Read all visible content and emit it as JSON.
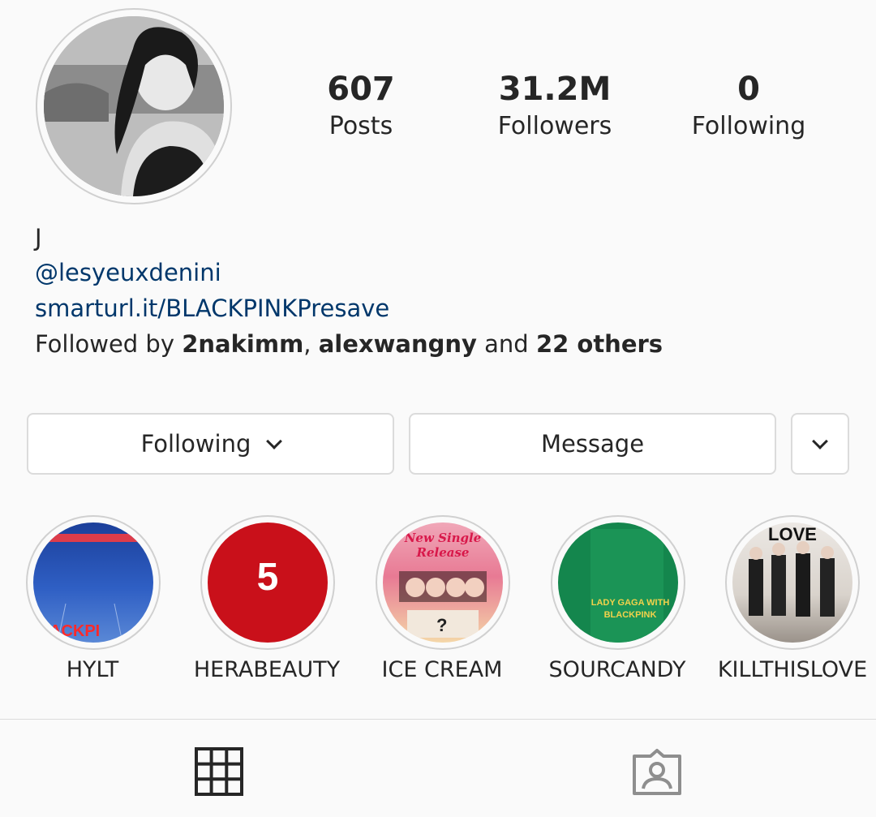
{
  "profile": {
    "name": "J",
    "mention": "@lesyeuxdenini",
    "link": "smarturl.it/BLACKPINKPresave"
  },
  "stats": [
    {
      "value": "607",
      "label": "Posts"
    },
    {
      "value": "31.2M",
      "label": "Followers"
    },
    {
      "value": "0",
      "label": "Following"
    }
  ],
  "followed_by": {
    "prefix": "Followed by ",
    "user1": "2nakimm",
    "sep": ", ",
    "user2": "alexwangny",
    "and": " and ",
    "others": "22 others"
  },
  "buttons": {
    "following": "Following",
    "message": "Message"
  },
  "highlights": [
    {
      "label": "HYLT",
      "thumb_text": "ACKPI"
    },
    {
      "label": "HERABEAUTY",
      "thumb_text": "5"
    },
    {
      "label": "ICE CREAM",
      "thumb_text": "New Single Release"
    },
    {
      "label": "SOURCANDY",
      "thumb_text": "LADY GAGA WITH BLACKPINK"
    },
    {
      "label": "KILLTHISLOVE",
      "thumb_text": "LOVE"
    }
  ],
  "tabs": [
    {
      "icon": "grid-icon"
    },
    {
      "icon": "tagged-icon"
    }
  ],
  "colors": {
    "link": "#00376b",
    "background": "#fafafa",
    "border": "#dbdbdb"
  }
}
